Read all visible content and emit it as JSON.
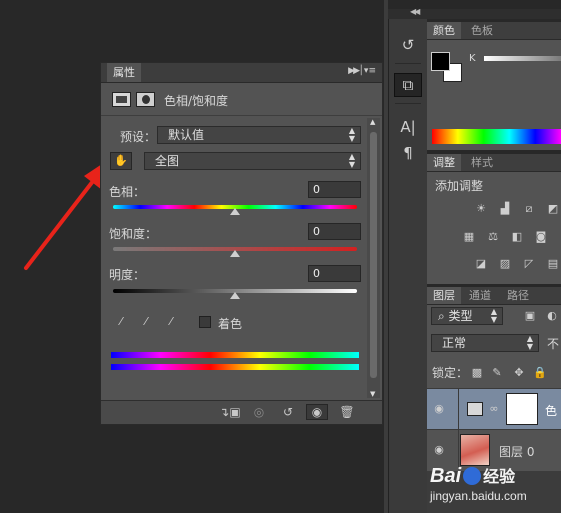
{
  "properties": {
    "tab_label": "属性",
    "adjustment_title": "色相/饱和度",
    "preset_label": "预设：",
    "preset_value": "默认值",
    "range_value": "全图",
    "hue_label": "色相：",
    "hue_value": "0",
    "saturation_label": "饱和度：",
    "saturation_value": "0",
    "lightness_label": "明度：",
    "lightness_value": "0",
    "colorize_label": "着色"
  },
  "color_panel": {
    "tab_color": "颜色",
    "tab_swatches": "色板",
    "slider_label": "K",
    "foreground": "#000000",
    "background": "#ffffff"
  },
  "adjust_panel": {
    "tab_adjust": "调整",
    "tab_styles": "样式",
    "add_label": "添加调整"
  },
  "layers_panel": {
    "tab_layers": "图层",
    "tab_channels": "通道",
    "tab_paths": "路径",
    "filter_kind": "类型",
    "blend_mode": "正常",
    "opacity_label_partial": "不",
    "lock_label": "锁定：",
    "layers": [
      {
        "name": "色",
        "kind": "adjustment"
      },
      {
        "name": "图层 0",
        "kind": "pixel"
      }
    ]
  },
  "watermark": {
    "brand": "Bai",
    "brand_tail": "经验",
    "url": "jingyan.baidu.com"
  },
  "annotation": {
    "color": "#e8231a"
  }
}
